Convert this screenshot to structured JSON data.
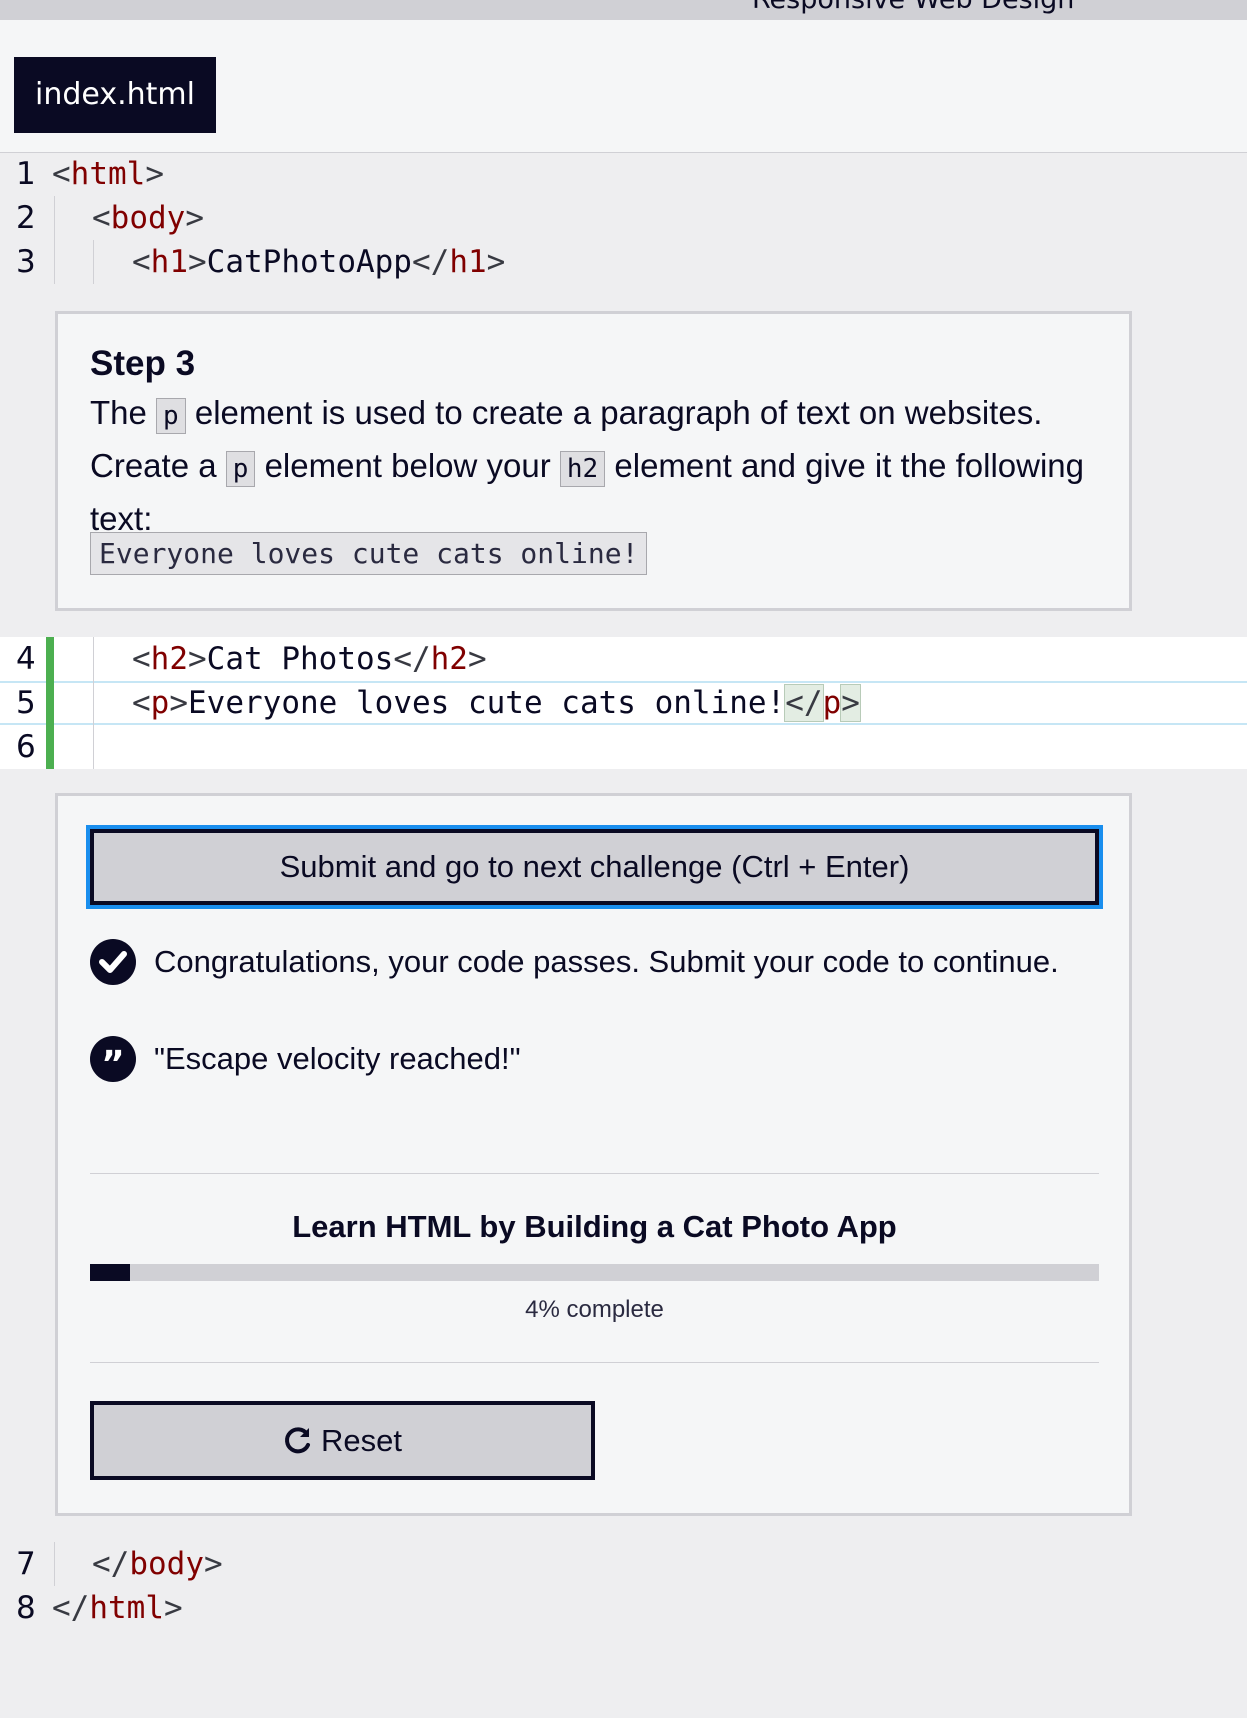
{
  "header": {
    "breadcrumb": "Responsive Web Design"
  },
  "tabs": [
    {
      "label": "index.html"
    }
  ],
  "editor": {
    "lines": [
      {
        "num": "1",
        "open": "<",
        "tag": "html",
        "close": ">"
      },
      {
        "num": "2",
        "open": "<",
        "tag": "body",
        "close": ">"
      },
      {
        "num": "3",
        "open": "<",
        "tag": "h1",
        "close": ">",
        "text": "CatPhotoApp",
        "endopen": "</",
        "endtag": "h1",
        "endclose": ">"
      },
      {
        "num": "4",
        "open": "<",
        "tag": "h2",
        "close": ">",
        "text": "Cat Photos",
        "endopen": "</",
        "endtag": "h2",
        "endclose": ">"
      },
      {
        "num": "5",
        "open": "<",
        "tag": "p",
        "close": ">",
        "text": "Everyone loves cute cats online!",
        "endopen": "</",
        "endtag": "p",
        "endclose": ">"
      },
      {
        "num": "6"
      },
      {
        "num": "7",
        "open": "</",
        "tag": "body",
        "close": ">"
      },
      {
        "num": "8",
        "open": "</",
        "tag": "html",
        "close": ">"
      }
    ]
  },
  "instructions": {
    "title": "Step 3",
    "p1_a": "The ",
    "code_p": "p",
    "p1_b": " element is used to create a paragraph of text on websites. Create a ",
    "p1_c": " element below your ",
    "code_h2": "h2",
    "p1_d": " element and give it the following text:",
    "block_code": "Everyone loves cute cats online!"
  },
  "actions": {
    "submit_label": "Submit and go to next challenge (Ctrl + Enter)",
    "success_message": "Congratulations, your code passes. Submit your code to continue.",
    "quote": "\"Escape velocity reached!\"",
    "course_title": "Learn HTML by Building a Cat Photo App",
    "progress_percent": 4,
    "progress_text": "4% complete",
    "reset_label": "Reset"
  },
  "colors": {
    "accent": "#198eee",
    "dark": "#0a0a23",
    "tag": "#800000",
    "editable_bar": "#4caf50"
  }
}
